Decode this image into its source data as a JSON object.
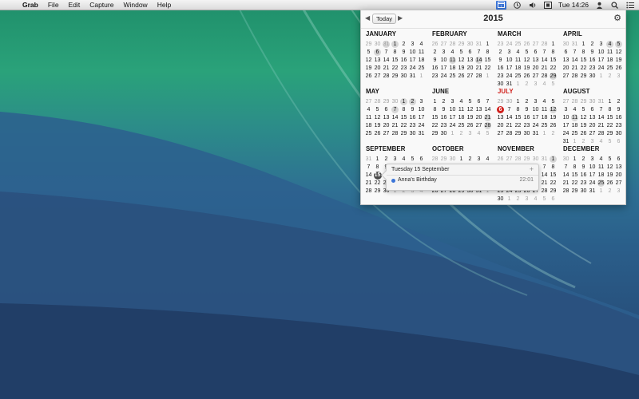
{
  "menubar": {
    "apple": "",
    "app_name": "Grab",
    "menus": [
      "File",
      "Edit",
      "Capture",
      "Window",
      "Help"
    ],
    "clock": "Tue 14:26"
  },
  "calendar": {
    "today_label": "Today",
    "prev": "◀",
    "next": "▶",
    "year": "2015",
    "gear": "⚙",
    "months": [
      {
        "name": "JANUARY",
        "days": [
          "29",
          "30",
          "31",
          "1",
          "2",
          "3",
          "4",
          "5",
          "6",
          "7",
          "8",
          "9",
          "10",
          "11",
          "12",
          "13",
          "14",
          "15",
          "16",
          "17",
          "18",
          "19",
          "20",
          "21",
          "22",
          "23",
          "24",
          "25",
          "26",
          "27",
          "28",
          "29",
          "30",
          "31",
          "1"
        ],
        "other": [
          0,
          1,
          2,
          34
        ],
        "week": [],
        "events": [
          2,
          3,
          8
        ]
      },
      {
        "name": "FEBRUARY",
        "days": [
          "26",
          "27",
          "28",
          "29",
          "30",
          "31",
          "1",
          "2",
          "3",
          "4",
          "5",
          "6",
          "7",
          "8",
          "9",
          "10",
          "11",
          "12",
          "13",
          "14",
          "15",
          "16",
          "17",
          "18",
          "19",
          "20",
          "21",
          "22",
          "23",
          "24",
          "25",
          "26",
          "27",
          "28",
          "1"
        ],
        "other": [
          0,
          1,
          2,
          3,
          4,
          5,
          34
        ],
        "week": [],
        "events": [
          19,
          16
        ]
      },
      {
        "name": "MARCH",
        "days": [
          "23",
          "24",
          "25",
          "26",
          "27",
          "28",
          "1",
          "2",
          "3",
          "4",
          "5",
          "6",
          "7",
          "8",
          "9",
          "10",
          "11",
          "12",
          "13",
          "14",
          "15",
          "16",
          "17",
          "18",
          "19",
          "20",
          "21",
          "22",
          "23",
          "24",
          "25",
          "26",
          "27",
          "28",
          "29",
          "30",
          "31",
          "1",
          "2",
          "3",
          "4",
          "5"
        ],
        "other": [
          0,
          1,
          2,
          3,
          4,
          5,
          37,
          38,
          39,
          40,
          41
        ],
        "week": [],
        "events": [
          34
        ]
      },
      {
        "name": "APRIL",
        "days": [
          "30",
          "31",
          "1",
          "2",
          "3",
          "4",
          "5",
          "6",
          "7",
          "8",
          "9",
          "10",
          "11",
          "12",
          "13",
          "14",
          "15",
          "16",
          "17",
          "18",
          "19",
          "20",
          "21",
          "22",
          "23",
          "24",
          "25",
          "26",
          "27",
          "28",
          "29",
          "30",
          "1",
          "2",
          "3"
        ],
        "other": [
          0,
          1,
          32,
          33,
          34
        ],
        "week": [],
        "events": [
          6,
          5
        ]
      },
      {
        "name": "MAY",
        "days": [
          "27",
          "28",
          "29",
          "30",
          "1",
          "2",
          "3",
          "4",
          "5",
          "6",
          "7",
          "8",
          "9",
          "10",
          "11",
          "12",
          "13",
          "14",
          "15",
          "16",
          "17",
          "18",
          "19",
          "20",
          "21",
          "22",
          "23",
          "24",
          "25",
          "26",
          "27",
          "28",
          "29",
          "30",
          "31"
        ],
        "other": [
          0,
          1,
          2,
          3
        ],
        "week": [],
        "events": [
          5,
          4,
          10
        ]
      },
      {
        "name": "JUNE",
        "days": [
          "1",
          "2",
          "3",
          "4",
          "5",
          "6",
          "7",
          "8",
          "9",
          "10",
          "11",
          "12",
          "13",
          "14",
          "15",
          "16",
          "17",
          "18",
          "19",
          "20",
          "21",
          "22",
          "23",
          "24",
          "25",
          "26",
          "27",
          "28",
          "29",
          "30",
          "1",
          "2",
          "3",
          "4",
          "5"
        ],
        "other": [
          30,
          31,
          32,
          33,
          34
        ],
        "week": [],
        "events": [
          20,
          27
        ]
      },
      {
        "name": "JULY",
        "days": [
          "29",
          "30",
          "1",
          "2",
          "3",
          "4",
          "5",
          "6",
          "7",
          "8",
          "9",
          "10",
          "11",
          "12",
          "13",
          "14",
          "15",
          "16",
          "17",
          "18",
          "19",
          "20",
          "21",
          "22",
          "23",
          "24",
          "25",
          "26",
          "27",
          "28",
          "29",
          "30",
          "31",
          "1",
          "2"
        ],
        "other": [
          0,
          1,
          33,
          34
        ],
        "week": [],
        "events": [
          13
        ],
        "today": 7
      },
      {
        "name": "AUGUST",
        "days": [
          "27",
          "28",
          "29",
          "30",
          "31",
          "1",
          "2",
          "3",
          "4",
          "5",
          "6",
          "7",
          "8",
          "9",
          "10",
          "11",
          "12",
          "13",
          "14",
          "15",
          "16",
          "17",
          "18",
          "19",
          "20",
          "21",
          "22",
          "23",
          "24",
          "25",
          "26",
          "27",
          "28",
          "29",
          "30",
          "31",
          "1",
          "2",
          "3",
          "4",
          "5",
          "6"
        ],
        "other": [
          0,
          1,
          2,
          3,
          4,
          36,
          37,
          38,
          39,
          40,
          41
        ],
        "week": [],
        "events": [
          15
        ]
      },
      {
        "name": "SEPTEMBER",
        "days": [
          "31",
          "1",
          "2",
          "3",
          "4",
          "5",
          "6",
          "7",
          "8",
          "9",
          "10",
          "11",
          "12",
          "13",
          "14",
          "15",
          "16",
          "17",
          "18",
          "19",
          "20",
          "21",
          "22",
          "23",
          "24",
          "25",
          "26",
          "27",
          "28",
          "29",
          "30",
          "1",
          "2",
          "3",
          "4"
        ],
        "other": [
          0,
          31,
          32,
          33,
          34
        ],
        "week": [],
        "events": [],
        "selected": 15
      },
      {
        "name": "OCTOBER",
        "days": [
          "28",
          "29",
          "30",
          "1",
          "2",
          "3",
          "4",
          "5",
          "6",
          "7",
          "8",
          "9",
          "10",
          "11",
          "12",
          "13",
          "14",
          "15",
          "16",
          "17",
          "18",
          "19",
          "20",
          "21",
          "22",
          "23",
          "24",
          "25",
          "26",
          "27",
          "28",
          "29",
          "30",
          "31",
          "1"
        ],
        "other": [
          0,
          1,
          2,
          34
        ],
        "week": [],
        "events": []
      },
      {
        "name": "NOVEMBER",
        "days": [
          "26",
          "27",
          "28",
          "29",
          "30",
          "31",
          "1",
          "2",
          "3",
          "4",
          "5",
          "6",
          "7",
          "8",
          "9",
          "10",
          "11",
          "12",
          "13",
          "14",
          "15",
          "16",
          "17",
          "18",
          "19",
          "20",
          "21",
          "22",
          "23",
          "24",
          "25",
          "26",
          "27",
          "28",
          "29",
          "30",
          "1",
          "2",
          "3",
          "4",
          "5",
          "6"
        ],
        "other": [
          0,
          1,
          2,
          3,
          4,
          5,
          36,
          37,
          38,
          39,
          40,
          41
        ],
        "week": [],
        "events": [
          6
        ]
      },
      {
        "name": "DECEMBER",
        "days": [
          "30",
          "1",
          "2",
          "3",
          "4",
          "5",
          "6",
          "7",
          "8",
          "9",
          "10",
          "11",
          "12",
          "13",
          "14",
          "15",
          "16",
          "17",
          "18",
          "19",
          "20",
          "21",
          "22",
          "23",
          "24",
          "25",
          "26",
          "27",
          "28",
          "29",
          "30",
          "31",
          "1",
          "2",
          "3"
        ],
        "other": [
          0,
          32,
          33,
          34
        ],
        "week": [],
        "events": [
          25
        ]
      }
    ]
  },
  "popover": {
    "date": "Tuesday 15 September",
    "add": "+",
    "event_name": "Anna's Birthday",
    "event_time": "22:01",
    "event_color": "#3a74d8"
  }
}
